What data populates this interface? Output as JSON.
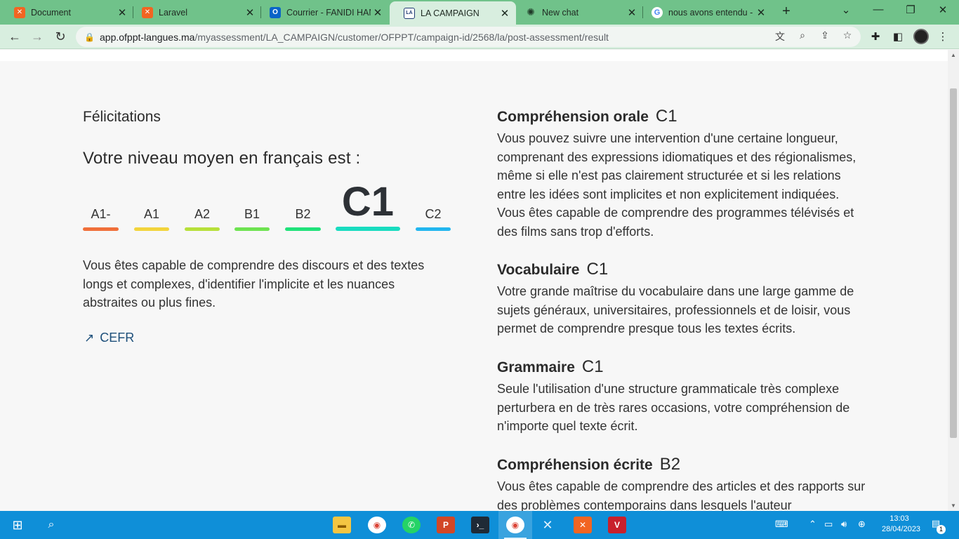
{
  "browser": {
    "tabs": [
      {
        "title": "Document",
        "favicon": "xampp-icon",
        "color": "#f26522"
      },
      {
        "title": "Laravel",
        "favicon": "xampp-icon",
        "color": "#f26522"
      },
      {
        "title": "Courrier - FANIDI HAM",
        "favicon": "outlook-icon",
        "color": "#0a64c8"
      },
      {
        "title": "LA CAMPAIGN",
        "favicon": "la-campaign-icon",
        "color": "#1f3b73"
      },
      {
        "title": "New chat",
        "favicon": "openai-icon",
        "color": "#6a8f78"
      },
      {
        "title": "nous avons entendu -",
        "favicon": "google-icon",
        "color": "#4285f4"
      }
    ],
    "url_host": "app.ofppt-langues.ma",
    "url_path": "/myassessment/LA_CAMPAIGN/customer/OFPPT/campaign-id/2568/la/post-assessment/result"
  },
  "result": {
    "congrats": "Félicitations",
    "average_label": "Votre niveau moyen en français est :",
    "selected_level": "C1",
    "levels": [
      {
        "label": "A1-",
        "color": "#f06f3a"
      },
      {
        "label": "A1",
        "color": "#f2d43c"
      },
      {
        "label": "A2",
        "color": "#b7e03a"
      },
      {
        "label": "B1",
        "color": "#6ee351"
      },
      {
        "label": "B2",
        "color": "#20e27a"
      },
      {
        "label": "C1",
        "color": "#19dcc0"
      },
      {
        "label": "C2",
        "color": "#22b6ef"
      }
    ],
    "description": "Vous êtes capable de comprendre des discours et des textes longs et complexes, d'identifier l'implicite et les nuances abstraites ou plus fines.",
    "cefr_link": "CEFR"
  },
  "skills": [
    {
      "name": "Compréhension orale",
      "level": "C1",
      "text": "Vous pouvez suivre une intervention d'une certaine longueur, comprenant des expressions idiomatiques et des régionalismes, même si elle n'est pas clairement structurée et si les relations entre les idées sont implicites et non explicitement indiquées. Vous êtes capable de comprendre des programmes télévisés et des films sans trop d'efforts."
    },
    {
      "name": "Vocabulaire",
      "level": "C1",
      "text": "Votre grande maîtrise du vocabulaire dans une large gamme de sujets généraux, universitaires, professionnels et de loisir, vous permet de comprendre presque tous les textes écrits."
    },
    {
      "name": "Grammaire",
      "level": "C1",
      "text": "Seule l'utilisation d'une structure grammaticale très complexe perturbera en de très rares occasions, votre compréhension de n'importe quel texte écrit."
    },
    {
      "name": "Compréhension écrite",
      "level": "B2",
      "text": "Vous êtes capable de comprendre des articles et des rapports sur des problèmes contemporains dans lesquels l'auteur"
    }
  ],
  "taskbar": {
    "time": "13:03",
    "date": "28/04/2023",
    "notification_count": "1",
    "apps": [
      "file-explorer-icon",
      "chrome-icon",
      "whatsapp-icon",
      "powerpoint-icon",
      "terminal-icon",
      "chrome-profile-icon",
      "vscode-icon",
      "xampp-icon",
      "app-icon"
    ]
  }
}
